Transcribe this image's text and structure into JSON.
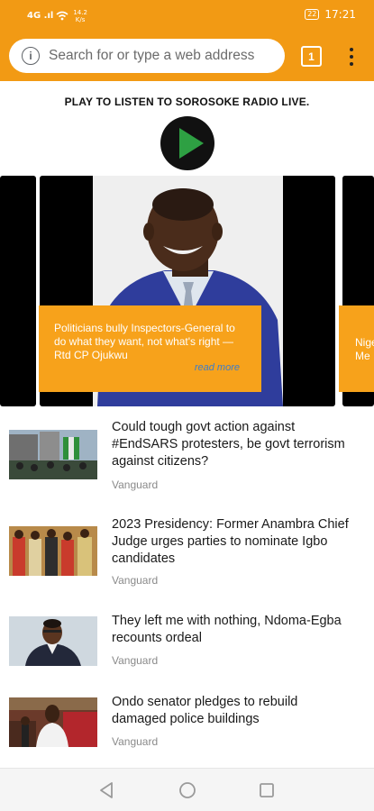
{
  "status_bar": {
    "signal": "4G .ıl",
    "speed_value": "14.2",
    "speed_unit": "K/s",
    "battery": "22",
    "time": "17:21"
  },
  "browser": {
    "url_placeholder": "Search for or type a web address",
    "tab_count": "1",
    "icons": [
      "info-icon",
      "tab-switcher-icon",
      "menu-icon"
    ]
  },
  "radio": {
    "label": "PLAY TO LISTEN TO SOROSOKE RADIO LIVE.",
    "play_icon_color": "#2ea043"
  },
  "carousel": {
    "caption": "Politicians bully Inspectors-General to do what they want, not what's right — Rtd CP Ojukwu",
    "read_more": "read more",
    "next_caption_partial": "Nige Me",
    "accent_color": "#f7a21b"
  },
  "news": [
    {
      "title": "Could tough govt action against #EndSARS protesters, be govt terrorism against citizens?",
      "source": "Vanguard"
    },
    {
      "title": "2023 Presidency: Former Anambra Chief Judge urges parties to nominate Igbo candidates",
      "source": "Vanguard"
    },
    {
      "title": "They left me with nothing, Ndoma-Egba recounts ordeal",
      "source": "Vanguard"
    },
    {
      "title": "Ondo senator pledges to rebuild damaged police buildings",
      "source": "Vanguard"
    }
  ],
  "nav": {
    "icons": [
      "back-icon",
      "home-icon",
      "recents-icon"
    ]
  }
}
